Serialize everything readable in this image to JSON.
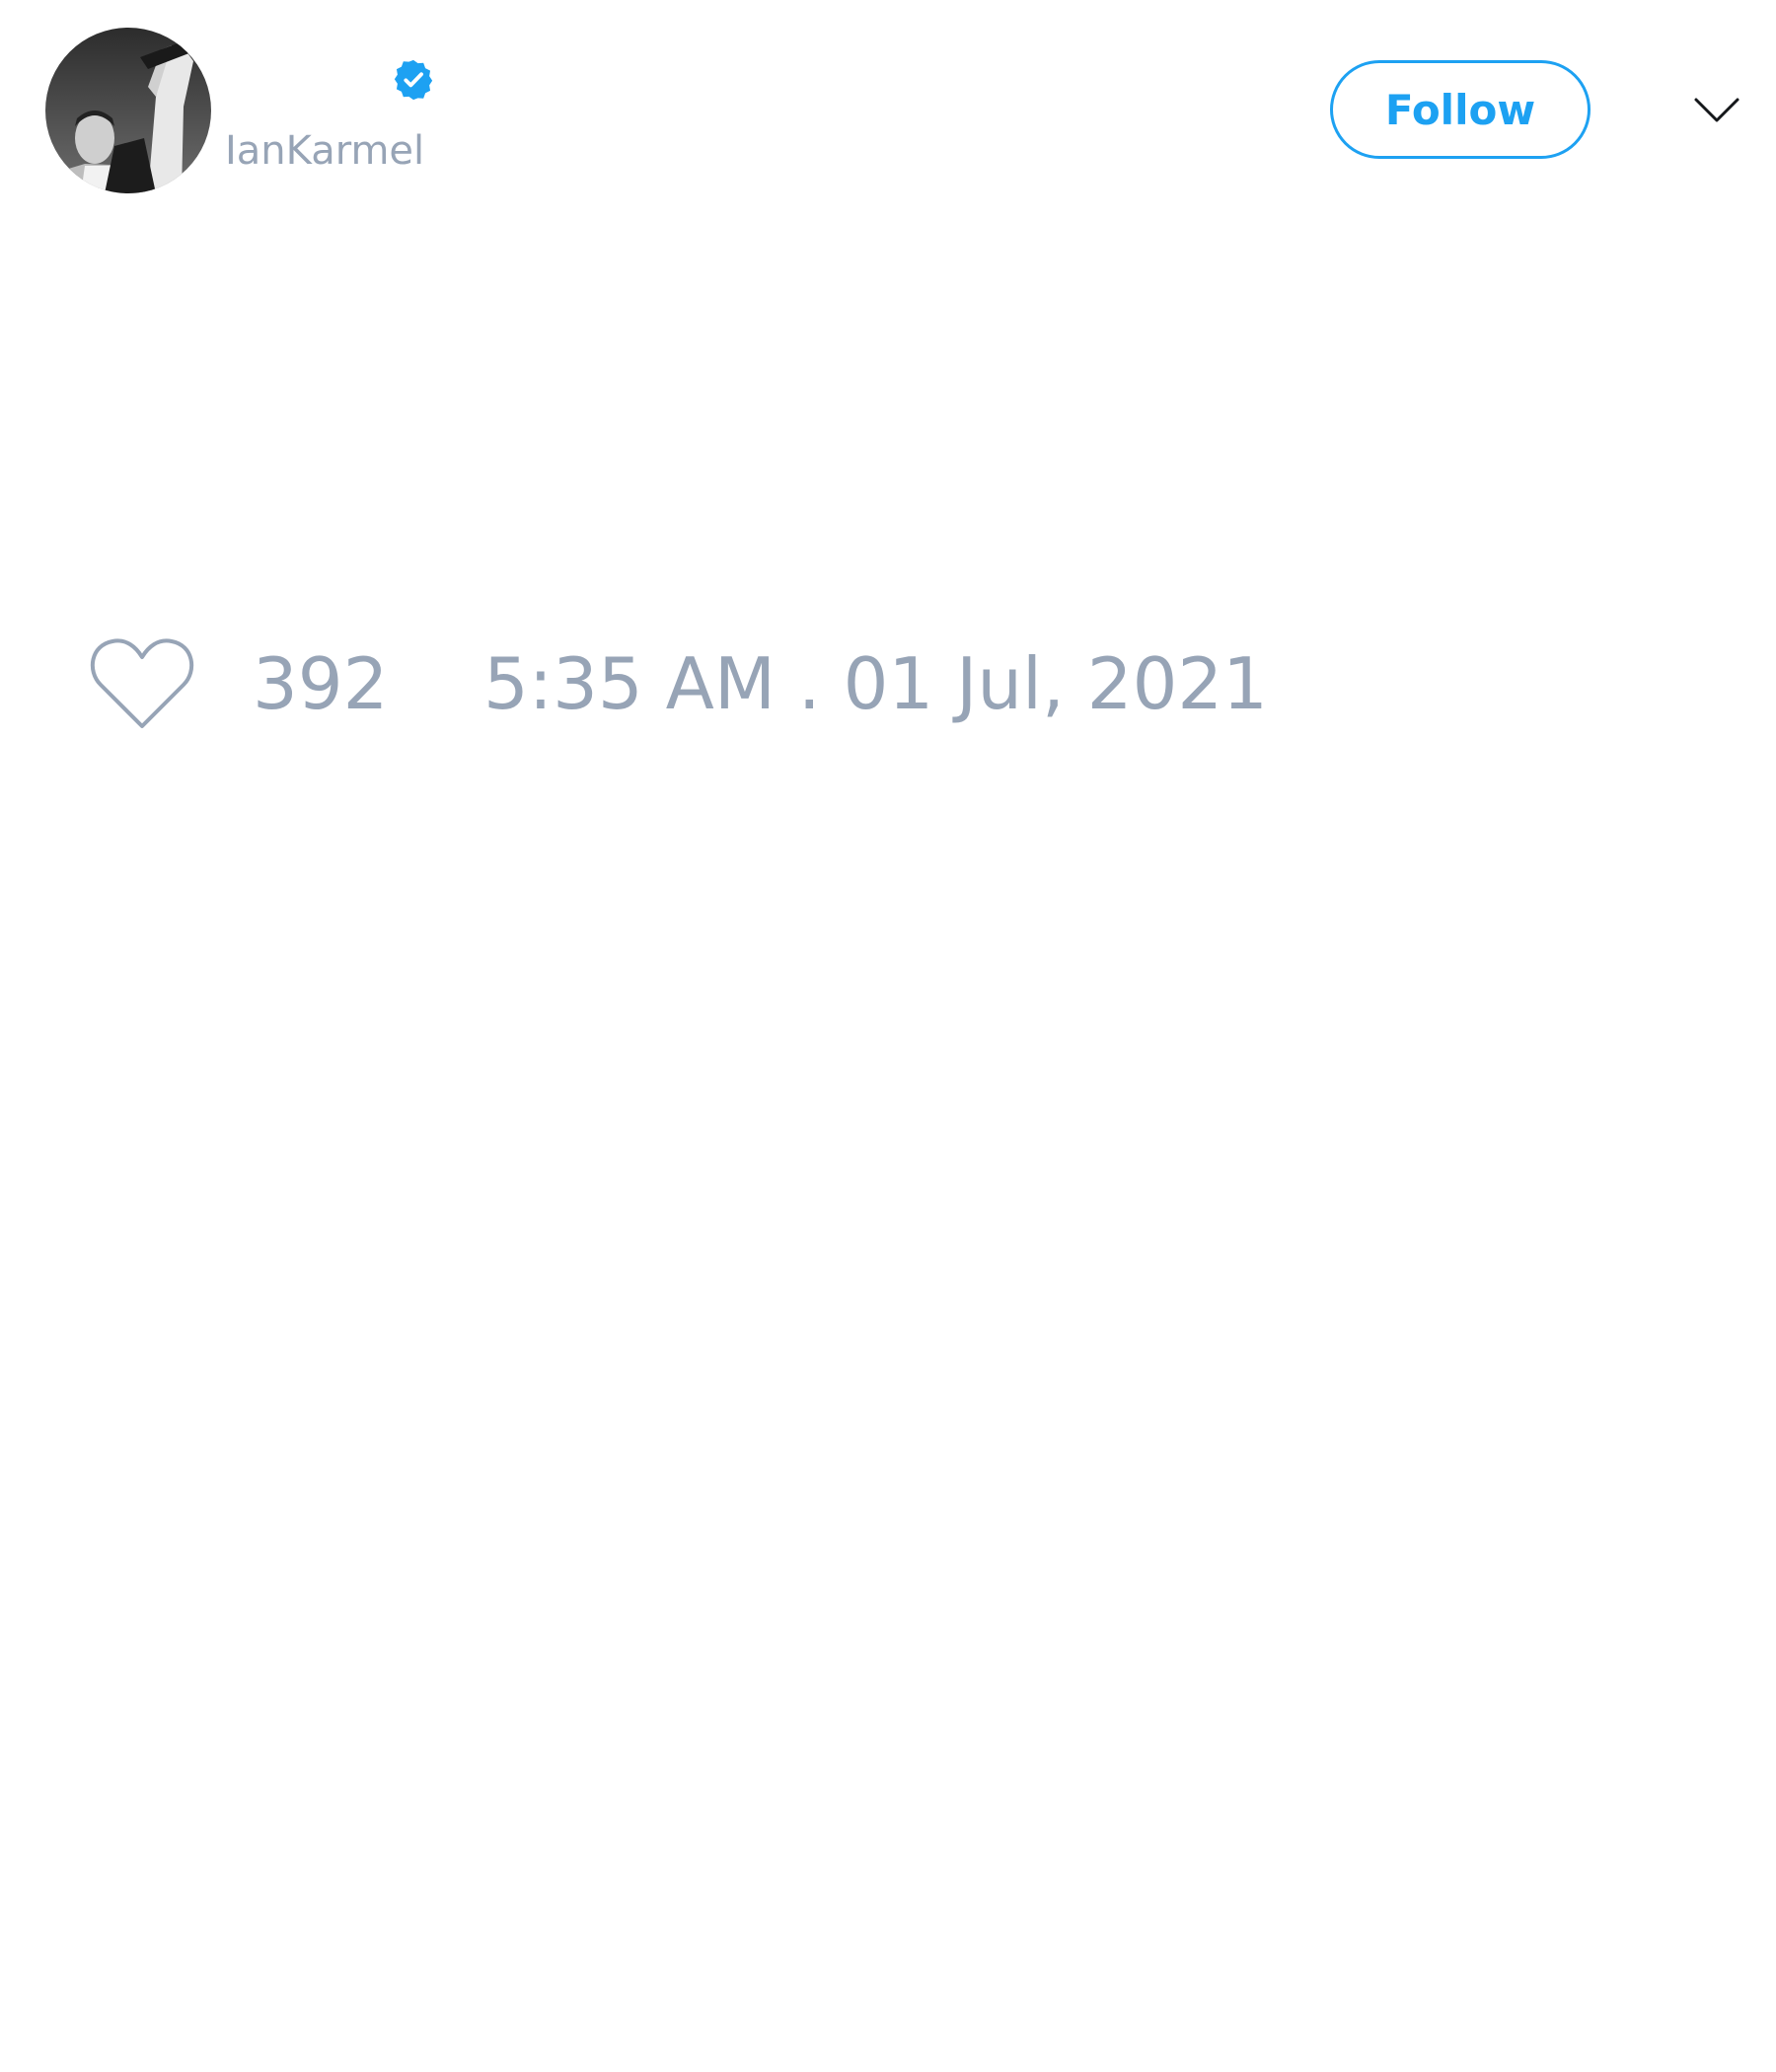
{
  "tweet": {
    "display_name": "",
    "username": "IanKarmel",
    "verified": true,
    "follow_label": "Follow",
    "like_count": "392",
    "timestamp": "5:35 AM . 01 Jul, 2021"
  },
  "icons": {
    "verified": "verified-badge-icon",
    "menu": "chevron-down-icon",
    "like": "heart-outline-icon"
  },
  "colors": {
    "accent": "#1da1f2",
    "muted_text": "#97a4b6",
    "background": "#ffffff"
  }
}
